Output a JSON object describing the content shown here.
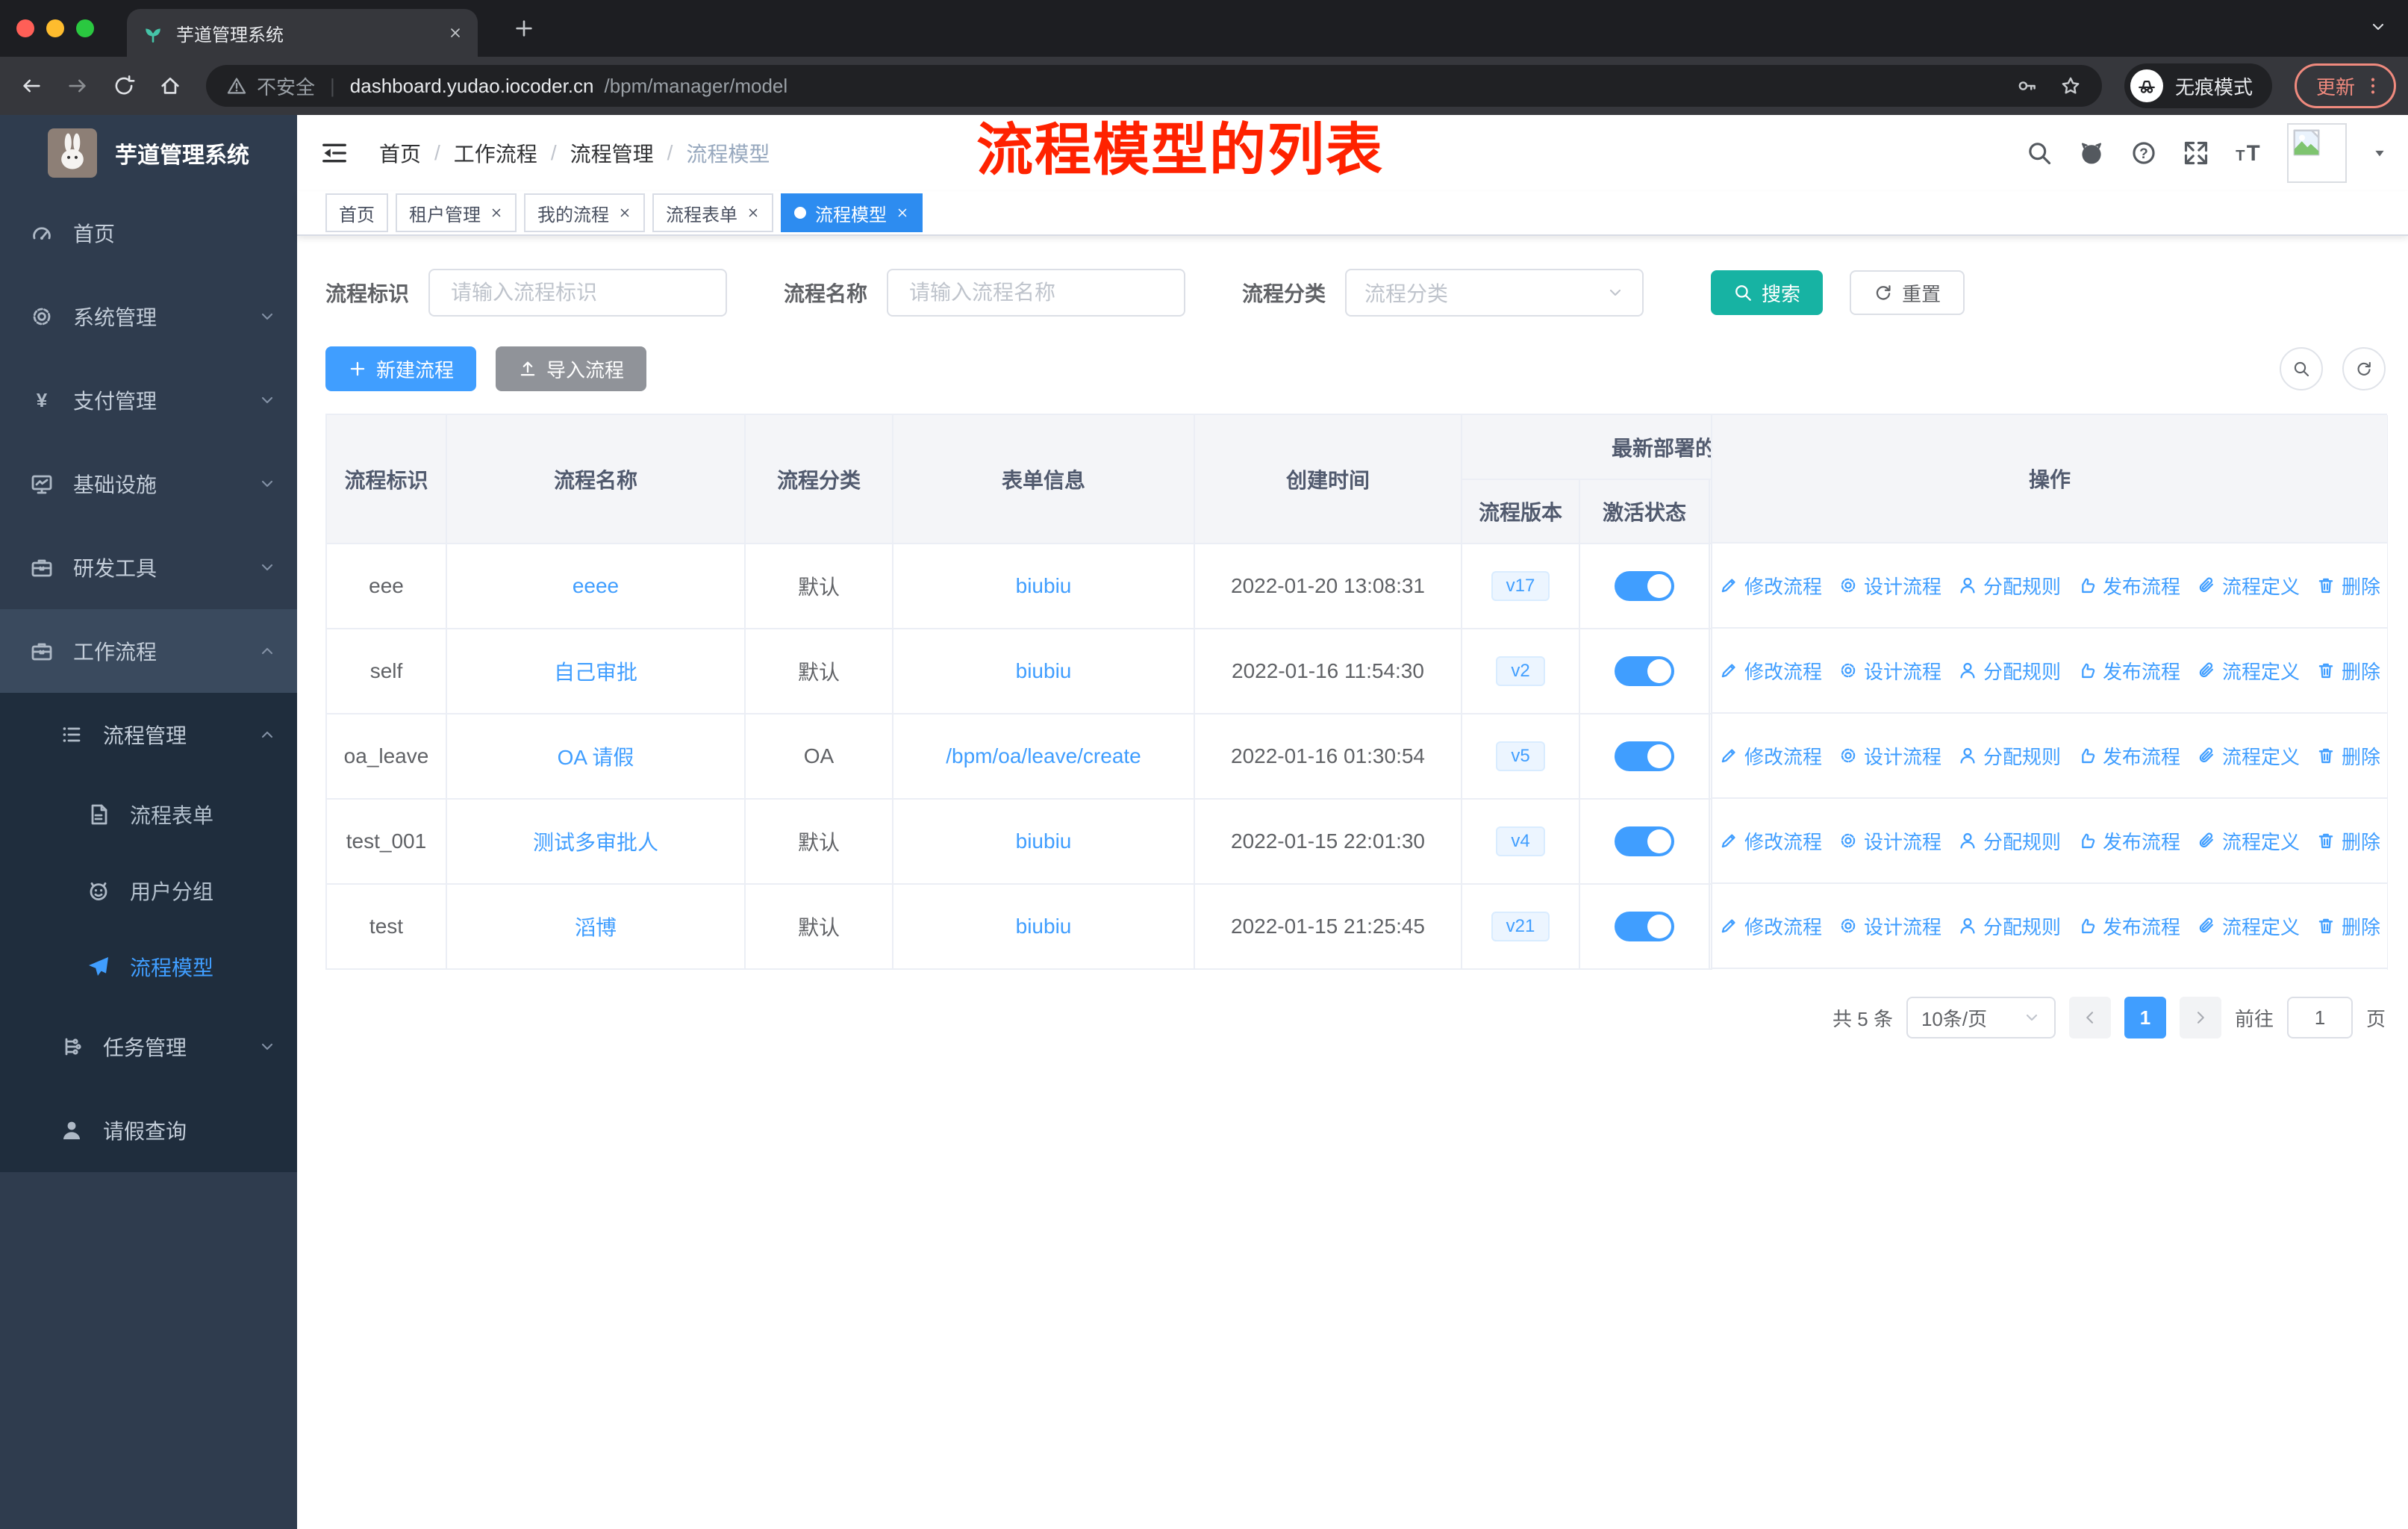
{
  "colors": {
    "accent": "#409eff",
    "teal_search": "#17b3a3",
    "import_gray": "#909399",
    "tag_active": "#2d8cf0",
    "annotation_red": "#ff2200",
    "sidebar_bg": "#2f3c4e",
    "sidebar_highlight": "#3a4a5e",
    "submenu_bg": "#1f2d3d",
    "table_header_bg": "#f4f5f8",
    "update_pill": "#f08a7e"
  },
  "browser": {
    "tab": {
      "title": "芋道管理系统"
    },
    "toolbar": {
      "security_label": "不安全",
      "url_domain": "dashboard.yudao.iocoder.cn",
      "url_path": "/bpm/manager/model",
      "incognito_label": "无痕模式",
      "update_label": "更新"
    }
  },
  "sidebar": {
    "logo_title": "芋道管理系统",
    "menu": [
      {
        "key": "home",
        "label": "首页",
        "icon": "gauge"
      },
      {
        "key": "system",
        "label": "系统管理",
        "icon": "gear",
        "arrow": "down"
      },
      {
        "key": "payment",
        "label": "支付管理",
        "icon": "yen",
        "arrow": "down"
      },
      {
        "key": "infrastructure",
        "label": "基础设施",
        "icon": "monitor",
        "arrow": "down"
      },
      {
        "key": "devtools",
        "label": "研发工具",
        "icon": "briefcase",
        "arrow": "down"
      },
      {
        "key": "workflow",
        "label": "工作流程",
        "icon": "briefcase",
        "arrow": "up",
        "highlight": true
      }
    ],
    "submenu": [
      {
        "key": "process-mgmt",
        "label": "流程管理",
        "icon": "list",
        "arrow": "up",
        "level": 1
      },
      {
        "key": "process-form",
        "label": "流程表单",
        "icon": "doc",
        "level": 2
      },
      {
        "key": "user-group",
        "label": "用户分组",
        "icon": "robot",
        "level": 2
      },
      {
        "key": "process-model",
        "label": "流程模型",
        "icon": "send",
        "level": 2,
        "active": true
      },
      {
        "key": "task-mgmt",
        "label": "任务管理",
        "icon": "tree",
        "arrow": "down",
        "level": 1
      },
      {
        "key": "leave-query",
        "label": "请假查询",
        "icon": "person",
        "level": 1
      }
    ]
  },
  "header": {
    "breadcrumb": [
      {
        "label": "首页"
      },
      {
        "label": "工作流程"
      },
      {
        "label": "流程管理"
      },
      {
        "label": "流程模型",
        "muted": true
      }
    ],
    "annotation": "流程模型的列表"
  },
  "tags": [
    {
      "key": "home",
      "label": "首页"
    },
    {
      "key": "tenant",
      "label": "租户管理",
      "closable": true
    },
    {
      "key": "my-process",
      "label": "我的流程",
      "closable": true
    },
    {
      "key": "process-form",
      "label": "流程表单",
      "closable": true
    },
    {
      "key": "process-model",
      "label": "流程模型",
      "closable": true,
      "active": true
    }
  ],
  "filter": {
    "id_label": "流程标识",
    "id_placeholder": "请输入流程标识",
    "name_label": "流程名称",
    "name_placeholder": "请输入流程名称",
    "category_label": "流程分类",
    "category_placeholder": "流程分类",
    "search_label": "搜索",
    "reset_label": "重置"
  },
  "toolbar": {
    "create_label": "新建流程",
    "import_label": "导入流程"
  },
  "table": {
    "columns": [
      "流程标识",
      "流程名称",
      "流程分类",
      "表单信息",
      "创建时间"
    ],
    "group_header": "最新部署的",
    "version_col": "流程版本",
    "status_col": "激活状态",
    "op_col": "操作",
    "row_actions": [
      {
        "key": "edit-process",
        "label": "修改流程",
        "icon": "edit"
      },
      {
        "key": "design-process",
        "label": "设计流程",
        "icon": "gear"
      },
      {
        "key": "assign-rule",
        "label": "分配规则",
        "icon": "user"
      },
      {
        "key": "publish-process",
        "label": "发布流程",
        "icon": "thumb"
      },
      {
        "key": "process-definition",
        "label": "流程定义",
        "icon": "clip"
      },
      {
        "key": "delete-process",
        "label": "删除",
        "icon": "trash"
      }
    ],
    "rows": [
      {
        "id": "eee",
        "name": "eeee",
        "category": "默认",
        "form": "biubiu",
        "created": "2022-01-20 13:08:31",
        "version": "v17",
        "active": true
      },
      {
        "id": "self",
        "name": "自己审批",
        "category": "默认",
        "form": "biubiu",
        "created": "2022-01-16 11:54:30",
        "version": "v2",
        "active": true
      },
      {
        "id": "oa_leave",
        "name": "OA 请假",
        "category": "OA",
        "form": "/bpm/oa/leave/create",
        "created": "2022-01-16 01:30:54",
        "version": "v5",
        "active": true
      },
      {
        "id": "test_001",
        "name": "测试多审批人",
        "category": "默认",
        "form": "biubiu",
        "created": "2022-01-15 22:01:30",
        "version": "v4",
        "active": true
      },
      {
        "id": "test",
        "name": "滔博",
        "category": "默认",
        "form": "biubiu",
        "created": "2022-01-15 21:25:45",
        "version": "v21",
        "active": true
      }
    ]
  },
  "pagination": {
    "total": "共 5 条",
    "page_size": "10条/页",
    "current": "1",
    "goto_label": "前往",
    "goto_value": "1",
    "page_unit": "页"
  }
}
